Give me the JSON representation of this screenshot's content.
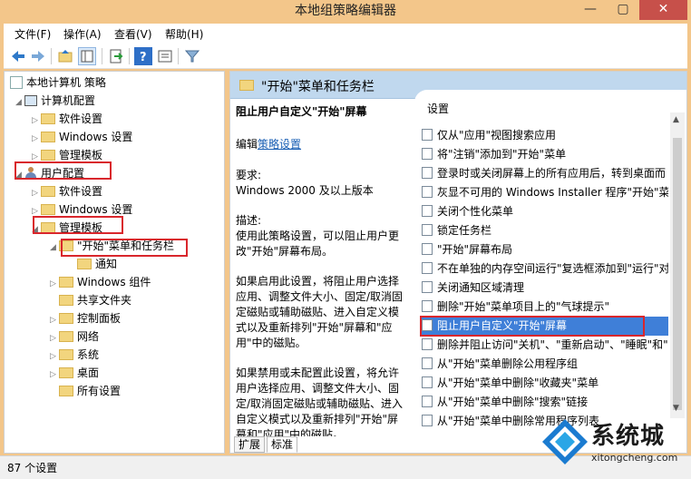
{
  "window": {
    "title": "本地组策略编辑器",
    "minimize": "—",
    "maximize": "▢",
    "close": "✕"
  },
  "menu": [
    "文件(F)",
    "操作(A)",
    "查看(V)",
    "帮助(H)"
  ],
  "toolbar_icons": [
    "back-icon",
    "forward-icon",
    "up-folder-icon",
    "show-tree-icon",
    "export-icon",
    "help-icon",
    "properties-icon",
    "filter-icon"
  ],
  "tree": {
    "root": "本地计算机 策略",
    "computer_config": "计算机配置",
    "cc_software": "软件设置",
    "cc_windows": "Windows 设置",
    "cc_admin": "管理模板",
    "user_config": "用户配置",
    "uc_software": "软件设置",
    "uc_windows": "Windows 设置",
    "uc_admin": "管理模板",
    "start_taskbar": "\"开始\"菜单和任务栏",
    "notify": "通知",
    "win_components": "Windows 组件",
    "shared_folders": "共享文件夹",
    "control_panel": "控制面板",
    "network": "网络",
    "system": "系统",
    "desktop": "桌面",
    "all_settings": "所有设置"
  },
  "pane_title": "\"开始\"菜单和任务栏",
  "description": {
    "title": "阻止用户自定义\"开始\"屏幕",
    "edit_prefix": "编辑",
    "edit_link": "策略设置",
    "req_label": "要求:",
    "req_value": "Windows 2000 及以上版本",
    "desc_label": "描述:",
    "desc_text": "使用此策略设置，可以阻止用户更改\"开始\"屏幕布局。",
    "enabled_text": "如果启用此设置，将阻止用户选择应用、调整文件大小、固定/取消固定磁贴或辅助磁贴、进入自定义模式以及重新排列\"开始\"屏幕和\"应用\"中的磁贴。",
    "disabled_text": "如果禁用或未配置此设置，将允许用户选择应用、调整文件大小、固定/取消固定磁贴或辅助磁贴、进入自定义模式以及重新排列\"开始\"屏幕和\"应用\"中的磁贴。"
  },
  "settings": {
    "header": "设置",
    "items": [
      "仅从\"应用\"视图搜索应用",
      "将\"注销\"添加到\"开始\"菜单",
      "登录时或关闭屏幕上的所有应用后，转到桌面而",
      "灰显不可用的 Windows Installer 程序\"开始\"菜",
      "关闭个性化菜单",
      "锁定任务栏",
      "\"开始\"屏幕布局",
      "不在单独的内存空间运行\"复选框添加到\"运行\"对",
      "关闭通知区域清理",
      "删除\"开始\"菜单项目上的\"气球提示\"",
      "阻止用户自定义\"开始\"屏幕",
      "删除并阻止访问\"关机\"、\"重新启动\"、\"睡眠\"和\"",
      "从\"开始\"菜单删除公用程序组",
      "从\"开始\"菜单中删除\"收藏夹\"菜单",
      "从\"开始\"菜单中删除\"搜索\"链接",
      "从\"开始\"菜单中删除常用程序列表"
    ],
    "selected_index": 10
  },
  "tabs": [
    "扩展",
    "标准"
  ],
  "status": "87 个设置",
  "watermark": {
    "text": "系统城",
    "url": "xitongcheng.com"
  },
  "colors": {
    "titlebar": "#f3c68a",
    "selection": "#3f7fd8",
    "highlight_box": "#d9262c",
    "pane_header": "#c0d8ee"
  }
}
